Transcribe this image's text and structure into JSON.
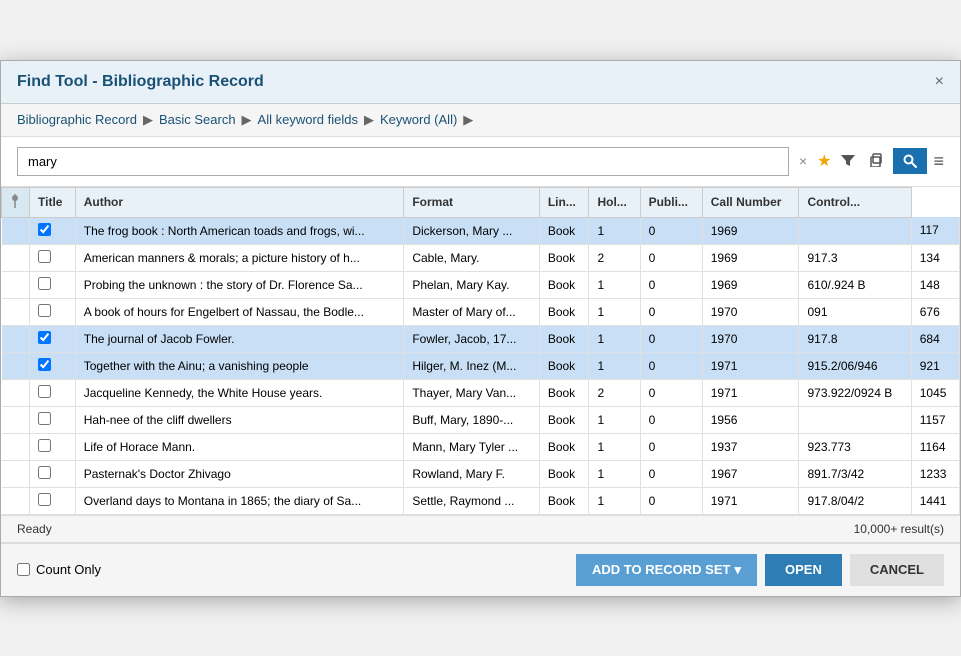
{
  "dialog": {
    "title": "Find Tool - Bibliographic Record",
    "close_label": "×"
  },
  "breadcrumb": {
    "items": [
      {
        "label": "Bibliographic Record",
        "sep": "▶"
      },
      {
        "label": "Basic Search",
        "sep": "▶"
      },
      {
        "label": "All keyword fields",
        "sep": "▶"
      },
      {
        "label": "Keyword (All)",
        "sep": "▶"
      }
    ]
  },
  "search": {
    "value": "mary",
    "clear_label": "×",
    "star_label": "★",
    "filter_label": "▼",
    "copy_label": "⎘",
    "search_label": "🔍",
    "menu_label": "≡"
  },
  "table": {
    "columns": [
      {
        "id": "check",
        "label": ""
      },
      {
        "id": "title",
        "label": "Title"
      },
      {
        "id": "author",
        "label": "Author"
      },
      {
        "id": "format",
        "label": "Format"
      },
      {
        "id": "lin",
        "label": "Lin..."
      },
      {
        "id": "hol",
        "label": "Hol..."
      },
      {
        "id": "publi",
        "label": "Publi..."
      },
      {
        "id": "callnum",
        "label": "Call Number"
      },
      {
        "id": "control",
        "label": "Control..."
      }
    ],
    "rows": [
      {
        "checked": true,
        "title": "The frog book : North American toads and frogs, wi...",
        "author": "Dickerson, Mary ...",
        "format": "Book",
        "lin": "1",
        "hol": "0",
        "publi": "1969",
        "callnum": "",
        "control": "117",
        "selected": true
      },
      {
        "checked": false,
        "title": "American manners & morals; a picture history of h...",
        "author": "Cable, Mary.",
        "format": "Book",
        "lin": "2",
        "hol": "0",
        "publi": "1969",
        "callnum": "917.3",
        "control": "134",
        "selected": false
      },
      {
        "checked": false,
        "title": "Probing the unknown : the story of Dr. Florence Sa...",
        "author": "Phelan, Mary Kay.",
        "format": "Book",
        "lin": "1",
        "hol": "0",
        "publi": "1969",
        "callnum": "610/.924 B",
        "control": "148",
        "selected": false
      },
      {
        "checked": false,
        "title": "A book of hours for Engelbert of Nassau, the Bodle...",
        "author": "Master of Mary of...",
        "format": "Book",
        "lin": "1",
        "hol": "0",
        "publi": "1970",
        "callnum": "091",
        "control": "676",
        "selected": false
      },
      {
        "checked": true,
        "title": "The journal of Jacob Fowler.",
        "author": "Fowler, Jacob, 17...",
        "format": "Book",
        "lin": "1",
        "hol": "0",
        "publi": "1970",
        "callnum": "917.8",
        "control": "684",
        "selected": true
      },
      {
        "checked": true,
        "title": "Together with the Ainu; a vanishing people",
        "author": "Hilger, M. Inez (M...",
        "format": "Book",
        "lin": "1",
        "hol": "0",
        "publi": "1971",
        "callnum": "915.2/06/946",
        "control": "921",
        "selected": true
      },
      {
        "checked": false,
        "title": "Jacqueline Kennedy, the White House years.",
        "author": "Thayer, Mary Van...",
        "format": "Book",
        "lin": "2",
        "hol": "0",
        "publi": "1971",
        "callnum": "973.922/0924 B",
        "control": "1045",
        "selected": false
      },
      {
        "checked": false,
        "title": "Hah-nee of the cliff dwellers",
        "author": "Buff, Mary, 1890-...",
        "format": "Book",
        "lin": "1",
        "hol": "0",
        "publi": "1956",
        "callnum": "",
        "control": "1157",
        "selected": false
      },
      {
        "checked": false,
        "title": "Life of Horace Mann.",
        "author": "Mann, Mary Tyler ...",
        "format": "Book",
        "lin": "1",
        "hol": "0",
        "publi": "1937",
        "callnum": "923.773",
        "control": "1164",
        "selected": false
      },
      {
        "checked": false,
        "title": "Pasternak's Doctor Zhivago",
        "author": "Rowland, Mary F.",
        "format": "Book",
        "lin": "1",
        "hol": "0",
        "publi": "1967",
        "callnum": "891.7/3/42",
        "control": "1233",
        "selected": false
      },
      {
        "checked": false,
        "title": "Overland days to Montana in 1865; the diary of Sa...",
        "author": "Settle, Raymond ...",
        "format": "Book",
        "lin": "1",
        "hol": "0",
        "publi": "1971",
        "callnum": "917.8/04/2",
        "control": "1441",
        "selected": false
      }
    ]
  },
  "statusbar": {
    "status": "Ready",
    "results": "10,000+ result(s)"
  },
  "footer": {
    "count_only_label": "Count Only",
    "add_btn": "ADD TO RECORD SET",
    "add_dropdown": "▾",
    "open_btn": "OPEN",
    "cancel_btn": "CANCEL"
  }
}
